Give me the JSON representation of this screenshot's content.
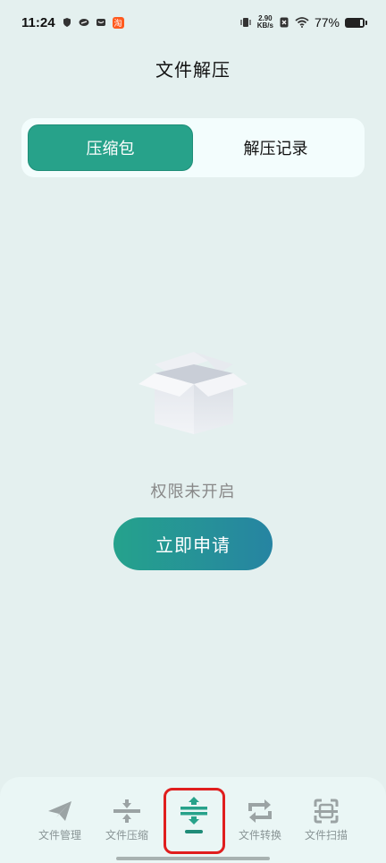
{
  "status_bar": {
    "time": "11:24",
    "net_speed_value": "2.90",
    "net_speed_unit": "KB/s",
    "battery_percent": "77%",
    "notification_badge": "淘"
  },
  "header": {
    "title": "文件解压"
  },
  "segment": {
    "tabs": [
      {
        "label": "压缩包",
        "active": true
      },
      {
        "label": "解压记录",
        "active": false
      }
    ]
  },
  "empty_state": {
    "message": "权限未开启",
    "action_label": "立即申请"
  },
  "bottom_nav": {
    "items": [
      {
        "label": "文件管理",
        "icon": "paper-plane-icon"
      },
      {
        "label": "文件压缩",
        "icon": "compress-icon"
      },
      {
        "label": "",
        "icon": "decompress-icon",
        "active": true
      },
      {
        "label": "文件转换",
        "icon": "convert-icon"
      },
      {
        "label": "文件扫描",
        "icon": "scan-icon"
      }
    ]
  },
  "colors": {
    "accent": "#27a28a",
    "background": "#e4f0ef",
    "highlight_frame": "#e01e1e"
  }
}
